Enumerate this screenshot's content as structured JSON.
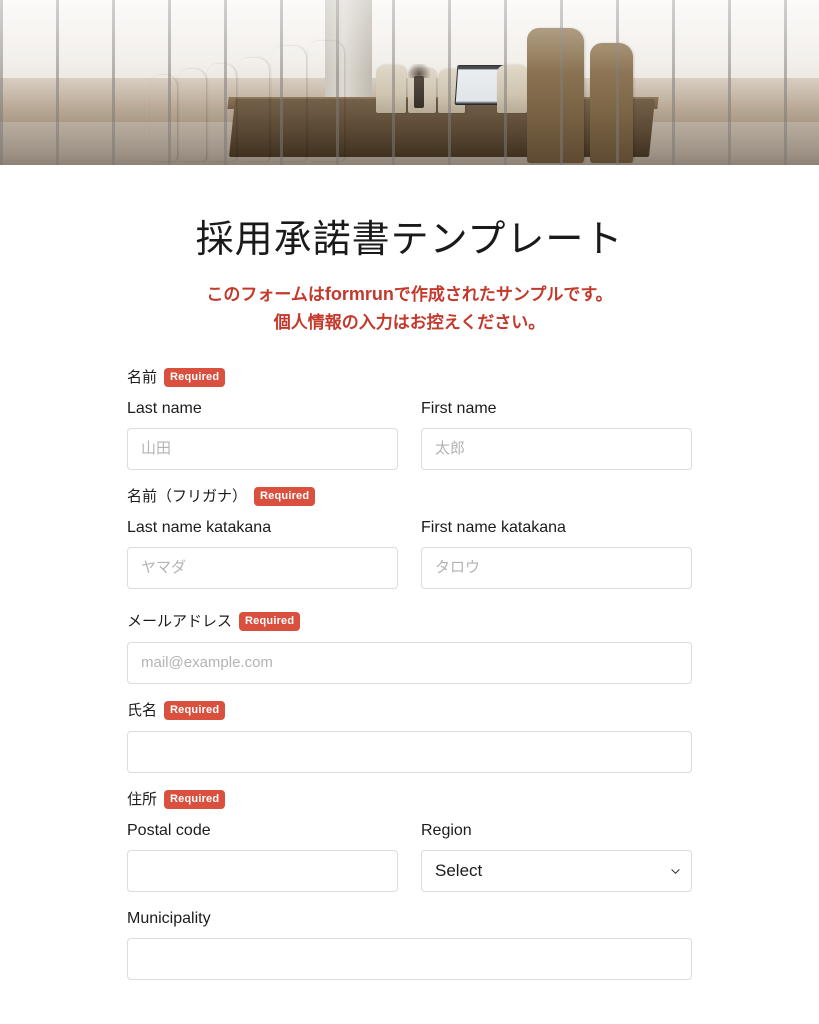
{
  "hero": {
    "alt": "conference-room-photo"
  },
  "form": {
    "title": "採用承諾書テンプレート",
    "subtitle_line1_pre": "このフォームは",
    "subtitle_brand": "formrun",
    "subtitle_line1_post": "で作成されたサンプルです。",
    "subtitle_line2": "個人情報の入力はお控えください。",
    "required_badge": "Required",
    "fields": [
      {
        "label": "名前",
        "required": true,
        "sub": [
          {
            "label": "Last name",
            "placeholder": "山田",
            "value": ""
          },
          {
            "label": "First name",
            "placeholder": "太郎",
            "value": ""
          }
        ]
      },
      {
        "label": "名前（フリガナ）",
        "required": true,
        "sub": [
          {
            "label": "Last name katakana",
            "placeholder": "ヤマダ",
            "value": ""
          },
          {
            "label": "First name katakana",
            "placeholder": "タロウ",
            "value": ""
          }
        ]
      },
      {
        "label": "メールアドレス",
        "required": true,
        "sub": [
          {
            "label": "",
            "placeholder": "mail@example.com",
            "value": ""
          }
        ]
      },
      {
        "label": "氏名",
        "required": true,
        "sub": [
          {
            "label": "",
            "placeholder": "",
            "value": ""
          }
        ]
      },
      {
        "label": "住所",
        "required": true,
        "sub": [
          {
            "label": "Postal code",
            "placeholder": "",
            "value": ""
          },
          {
            "label": "Region",
            "placeholder": "",
            "value": "Select"
          },
          {
            "label": "Municipality",
            "placeholder": "",
            "value": ""
          }
        ]
      }
    ],
    "region_select": {
      "selected": "Select",
      "icon": "chevron-down-icon"
    }
  },
  "colors": {
    "accent_red": "#c3392b",
    "badge_red": "#d9503f",
    "text": "#1c1c1c",
    "border": "#dcdcdc",
    "placeholder": "#b3b3b3",
    "background": "#ffffff"
  }
}
